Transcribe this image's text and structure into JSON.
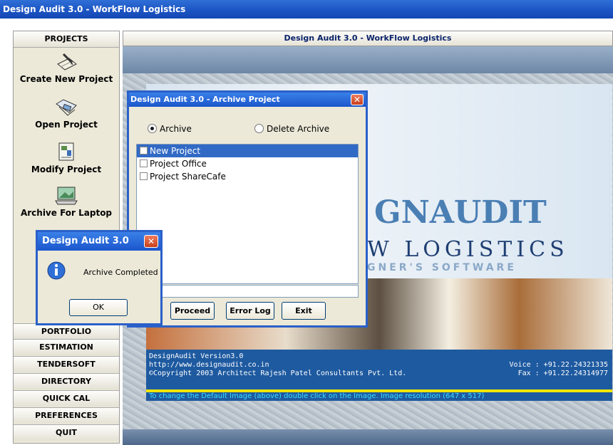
{
  "app": {
    "title": "Design Audit 3.0 - WorkFlow Logistics"
  },
  "left": {
    "header": "PROJECTS",
    "items": [
      {
        "label": "Create New Project",
        "icon": "pen-notepad-icon"
      },
      {
        "label": "Open Project",
        "icon": "open-folder-icon"
      },
      {
        "label": "Modify Project",
        "icon": "modify-document-icon"
      },
      {
        "label": "Archive For Laptop",
        "icon": "laptop-icon"
      }
    ],
    "buttons": [
      "PORTFOLIO",
      "ESTIMATION",
      "TENDERSOFT",
      "DIRECTORY",
      "QUICK CAL",
      "PREFERENCES",
      "QUIT"
    ]
  },
  "right": {
    "header": "Design Audit 3.0 - WorkFlow Logistics"
  },
  "splash": {
    "logo": "GNAUDIT",
    "logo_sub": "W LOGISTICS",
    "logo_tag": "GNER'S SOFTWARE",
    "version": "DesignAudit Version3.0",
    "url": "http://www.designaudit.co.in",
    "copyright": "©Copyright 2003 Architect Rajesh Patel Consultants Pvt. Ltd.",
    "voice": "Voice : +91.22.24321335",
    "fax": "Fax : +91.22.24314977",
    "hint": "To change the Default Image (above) double click on the Image. Image resolution (647 x 517)"
  },
  "archive_dialog": {
    "title": "Design Audit 3.0 - Archive Project",
    "radio_archive": "Archive",
    "radio_delete": "Delete Archive",
    "projects": [
      "New Project",
      "Project Office",
      "Project ShareCafe"
    ],
    "btn_proceed": "Proceed",
    "btn_errorlog": "Error Log",
    "btn_exit": "Exit"
  },
  "msgbox": {
    "title": "Design Audit 3.0",
    "message": "Archive Completed",
    "ok": "OK"
  },
  "colors": {
    "title_blue": "#1b53c2",
    "info_blue": "#1e5aa0",
    "hint_cyan": "#38e0ff",
    "selection": "#316ac5"
  }
}
